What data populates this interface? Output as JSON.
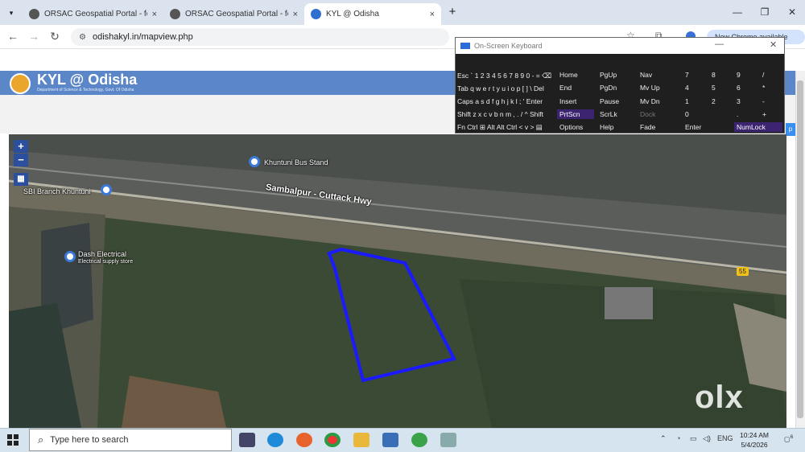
{
  "browser": {
    "tabs": [
      {
        "title": "ORSAC Geospatial Portal - for R"
      },
      {
        "title": "ORSAC Geospatial Portal - for R"
      },
      {
        "title": "KYL @ Odisha"
      }
    ],
    "url": "odishakyl.in/mapview.php",
    "chrome_banner": "New Chrome available",
    "new_tab_symbol": "+",
    "close_symbol": "×"
  },
  "site": {
    "title": "KYL @ Odisha",
    "subtitle": "Department of Science & Technology, Govt. Of Odisha",
    "logo_text": "KYL"
  },
  "map": {
    "zoom_in": "+",
    "zoom_out": "−",
    "labels": {
      "bus_stand": "Khuntuni Bus Stand",
      "highway": "Sambalpur - Cuttack Hwy",
      "sbi": "SBI Branch Khuntuni",
      "dash_name": "Dash Electrical",
      "dash_sub": "Electrical supply store",
      "route": "55"
    },
    "watermark": "olx",
    "parcel_color": "#1a1aff"
  },
  "keyboard": {
    "title": "On-Screen Keyboard",
    "row1": "Esc ` 1 2 3 4 5 6 7 8 9 0 - = ⌫",
    "row2": "Tab q w e r t y u i o p [ ] \\ Del",
    "row3": "Caps a s d f g h j k l ; ' Enter",
    "row4": "Shift z x c v b n m , . / ^ Shift",
    "row5": "Fn Ctrl ⊞ Alt        Alt Ctrl < v > ▤",
    "nav_keys": [
      [
        "Home",
        "PgUp",
        "Nav"
      ],
      [
        "End",
        "PgDn",
        "Mv Up"
      ],
      [
        "Insert",
        "Pause",
        "Mv Dn"
      ],
      [
        "PrtScn",
        "ScrLk",
        "Dock"
      ],
      [
        "Options",
        "Help",
        "Fade"
      ]
    ],
    "numpad": [
      [
        "7",
        "8",
        "9",
        "/"
      ],
      [
        "4",
        "5",
        "6",
        "*"
      ],
      [
        "1",
        "2",
        "3",
        "-"
      ],
      [
        "0",
        "",
        ".",
        "+"
      ],
      [
        "Enter",
        "",
        "NumLock",
        ""
      ]
    ]
  },
  "taskbar": {
    "search_placeholder": "Type here to search",
    "time": "10:24 AM",
    "date": "5/4/2026",
    "lang": "ENG",
    "notif": "6"
  }
}
